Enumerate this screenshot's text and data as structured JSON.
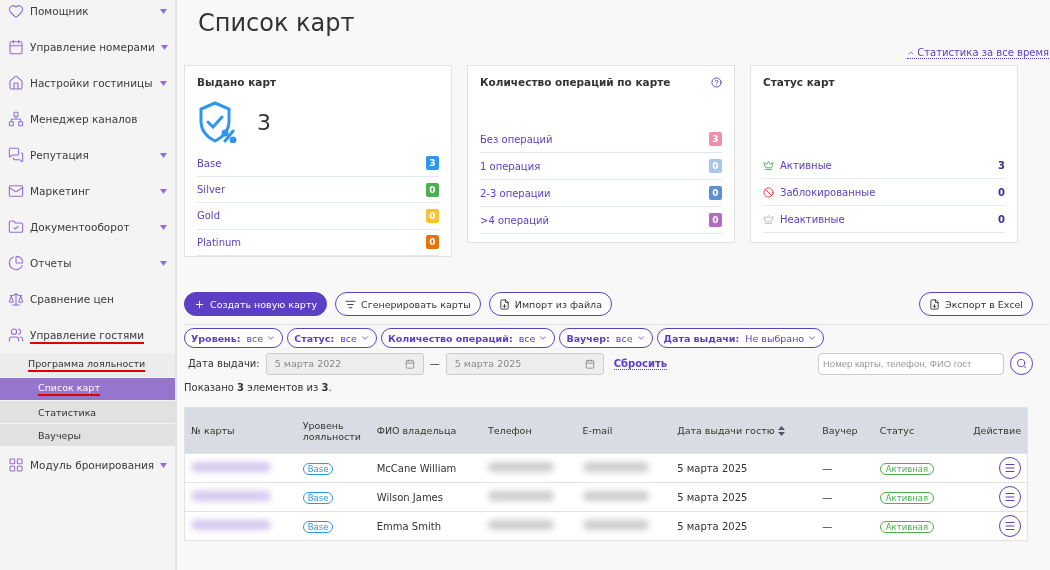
{
  "sidebar": {
    "items": [
      {
        "label": "Помощник",
        "expandable": true,
        "underlined": false
      },
      {
        "label": "Управление номерами",
        "expandable": true,
        "underlined": false
      },
      {
        "label": "Настройки гостиницы",
        "expandable": true,
        "underlined": false
      },
      {
        "label": "Менеджер каналов",
        "expandable": false,
        "underlined": false
      },
      {
        "label": "Репутация",
        "expandable": true,
        "underlined": false
      },
      {
        "label": "Маркетинг",
        "expandable": true,
        "underlined": false
      },
      {
        "label": "Документооборот",
        "expandable": true,
        "underlined": false
      },
      {
        "label": "Отчеты",
        "expandable": true,
        "underlined": false
      },
      {
        "label": "Сравнение цен",
        "expandable": false,
        "underlined": false
      },
      {
        "label": "Управление гостями",
        "expandable": false,
        "underlined": true,
        "children": [
          {
            "label": "Программа лояльности",
            "underlined": true,
            "selected": false,
            "children": [
              {
                "label": "Список карт",
                "underlined": true,
                "selected": true
              },
              {
                "label": "Статистика",
                "underlined": false,
                "selected": false
              },
              {
                "label": "Ваучеры",
                "underlined": false,
                "selected": false
              }
            ]
          }
        ]
      },
      {
        "label": "Модуль бронирования",
        "expandable": true,
        "underlined": false
      }
    ]
  },
  "page": {
    "title": "Список карт",
    "stats_link": "Статистика за все время"
  },
  "cards": [
    {
      "title": "Выдано карт",
      "kind": "issued",
      "total": "3",
      "help": false,
      "rows": [
        {
          "label": "Base",
          "count": "3",
          "color": "#2f96f0"
        },
        {
          "label": "Silver",
          "count": "0",
          "color": "#4caf50"
        },
        {
          "label": "Gold",
          "count": "0",
          "color": "#fbc02d"
        },
        {
          "label": "Platinum",
          "count": "0",
          "color": "#e8710a"
        }
      ]
    },
    {
      "title": "Количество операций по карте",
      "kind": "operations",
      "help": true,
      "rows": [
        {
          "label": "Без операций",
          "count": "3",
          "color": "#ee8fa8"
        },
        {
          "label": "1 операция",
          "count": "0",
          "color": "#a9c6ea"
        },
        {
          "label": "2-3 операции",
          "count": "0",
          "color": "#5b8fd4"
        },
        {
          "label": ">4 операций",
          "count": "0",
          "color": "#b36bc4"
        }
      ]
    },
    {
      "title": "Статус карт",
      "kind": "status",
      "help": false,
      "rows": [
        {
          "label": "Активные",
          "count": "3",
          "kind": "active"
        },
        {
          "label": "Заблокированные",
          "count": "0",
          "kind": "blocked"
        },
        {
          "label": "Неактивные",
          "count": "0",
          "kind": "inactive"
        }
      ]
    }
  ],
  "toolbar": {
    "buttons": [
      {
        "label": "Создать новую карту",
        "kind": "primary"
      },
      {
        "label": "Сгенерировать карты",
        "kind": "outline"
      },
      {
        "label": "Импорт из файла",
        "kind": "outline"
      }
    ],
    "export": {
      "label": "Экспорт в Excel"
    }
  },
  "filters": [
    {
      "label": "Уровень:",
      "value": "все"
    },
    {
      "label": "Статус:",
      "value": "все"
    },
    {
      "label": "Количество операций:",
      "value": "все"
    },
    {
      "label": "Ваучер:",
      "value": "все"
    },
    {
      "label": "Дата выдачи:",
      "value": "Не выбрано"
    }
  ],
  "date_filter": {
    "label": "Дата выдачи:",
    "from": "5 марта 2022",
    "to": "5 марта 2025",
    "separator": "—",
    "reset": "Сбросить"
  },
  "search": {
    "placeholder": "Номер карты, телефон, ФИО гост"
  },
  "summary": "Показано **3** элементов из **3**.",
  "table": {
    "columns": [
      {
        "label": "№ карты",
        "sortable": false
      },
      {
        "label": "Уровень лояльности",
        "sortable": false
      },
      {
        "label": "ФИО владельца",
        "sortable": false
      },
      {
        "label": "Телефон",
        "sortable": false
      },
      {
        "label": "E-mail",
        "sortable": false
      },
      {
        "label": "Дата выдачи гостю",
        "sortable": true
      },
      {
        "label": "Ваучер",
        "sortable": false
      },
      {
        "label": "Статус",
        "sortable": false
      },
      {
        "label": "Действие",
        "sortable": false
      }
    ],
    "rows": [
      {
        "level": "Base",
        "owner": "McCane William",
        "issued": "5 марта 2025",
        "voucher": "—",
        "status": "Активная"
      },
      {
        "level": "Base",
        "owner": "Wilson James",
        "issued": "5 марта 2025",
        "voucher": "—",
        "status": "Активная"
      },
      {
        "level": "Base",
        "owner": "Emma Smith",
        "issued": "5 марта 2025",
        "voucher": "—",
        "status": "Активная"
      }
    ]
  }
}
